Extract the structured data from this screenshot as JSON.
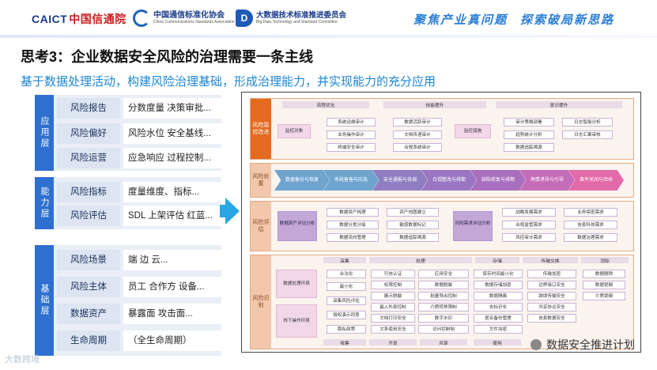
{
  "header": {
    "logo_caict_en": "CAICT",
    "logo_caict_cn": "中国信通院",
    "logo_ccsa_cn": "中国通信标准化协会",
    "logo_ccsa_en": "China Communications Standards Association",
    "logo_bd_cn": "大数据技术标准推进委员会",
    "logo_bd_en": "Big Data Technology and Standard Committee",
    "slogan_1": "聚焦产业真问题",
    "slogan_2": "探索破局新思路"
  },
  "title": "思考3：企业数据安全风险的治理需要一条主线",
  "subtitle": "基于数据处理活动，构建风险治理基础，形成治理能力，并实现能力的充分应用",
  "left_groups": [
    {
      "label": "应用层",
      "rows": [
        {
          "name": "风险报告",
          "desc": "分数度量 决策审批..."
        },
        {
          "name": "风险偏好",
          "desc": "风险水位 安全基线..."
        },
        {
          "name": "风险运营",
          "desc": "应急响应 过程控制..."
        }
      ]
    },
    {
      "label": "能力层",
      "rows": [
        {
          "name": "风险指标",
          "desc": "度量维度、指标..."
        },
        {
          "name": "风险评估",
          "desc": "SDL 上架评估 红蓝..."
        }
      ]
    },
    {
      "label": "基础层",
      "rows": [
        {
          "name": "风险场景",
          "desc": "端 边 云..."
        },
        {
          "name": "风险主体",
          "desc": "员工 合作方 设备..."
        },
        {
          "name": "数据资产",
          "desc": "暴露面 攻击面..."
        },
        {
          "name": "生命周期",
          "desc": "（全生命周期）"
        }
      ]
    }
  ],
  "diagram": {
    "s1": {
      "side": "风险监控改进",
      "headers": [
        "流程优化",
        "技能提升",
        "意识提升"
      ],
      "a": "监控对象",
      "b": [
        "系统运维审计",
        "业务操作审计",
        "终端安全审计"
      ],
      "c": [
        "数据活跃审计",
        "文档传递审计",
        "合规系统审计"
      ],
      "d": "监控措施",
      "e": [
        "审计策略部署",
        "趋势统计分析",
        "数据追踪溯源"
      ],
      "f": [
        "日志智能分析",
        "日志汇聚审核"
      ]
    },
    "s2": {
      "side": "风险处置",
      "steps": [
        "数据备份与恢复",
        "系统备备与应急",
        "安全通报与协调",
        "合规整改与排期",
        "缺陷修复与排期",
        "舆情诱导与引导",
        "事件关闭与验收"
      ]
    },
    "s3": {
      "side": "风险评估",
      "a": "数据资产评估分析",
      "b": [
        "数据资产梳理",
        "数据分类分级",
        "数据流向管理"
      ],
      "c": [
        "资产地图建立",
        "敏感数据标记",
        "数据追踪溯源"
      ],
      "d": "风险需求评估分析",
      "e": [
        "战略发展需求",
        "合规监管需求",
        "风控审计需求"
      ],
      "f": [
        "业务保密需求",
        "信息科技需求",
        "数据治理需求"
      ]
    },
    "s4": {
      "side": "风险识别",
      "top_headers": [
        "采集",
        "处理",
        "存储",
        "传输交换",
        "消除"
      ],
      "bottom_headers": [
        "收集",
        "开发",
        "共享",
        "使用"
      ],
      "a1": "数据处理环境",
      "a2": "线下操作环境",
      "col1": [
        "合法化",
        "最小化",
        "采集风险评估",
        "授权演示同意",
        "隐私政策"
      ],
      "col2": [
        "可信认证",
        "权限控制",
        "展示脱敏",
        "最入外部控制",
        "文档打印安全",
        "文系使用安全"
      ],
      "col3": [
        "应用安全",
        "数据脱敏",
        "批量导出控制",
        "介质转移限制",
        "数字水印",
        "访问控制制"
      ],
      "col4": [
        "保存时间最小化",
        "数据存储加密",
        "数据隔离",
        "去标识化",
        "匿名备份管理",
        "文件加密"
      ],
      "col5": [
        "传输加密",
        "边界接口安全",
        "跨境传输安全",
        "共享协议安全",
        "信息数据安全"
      ],
      "col6": [
        "数据删除",
        "数据销毁",
        "介质销毁"
      ]
    }
  },
  "watermark": "数据安全推进计划",
  "footer": "大数跨境"
}
